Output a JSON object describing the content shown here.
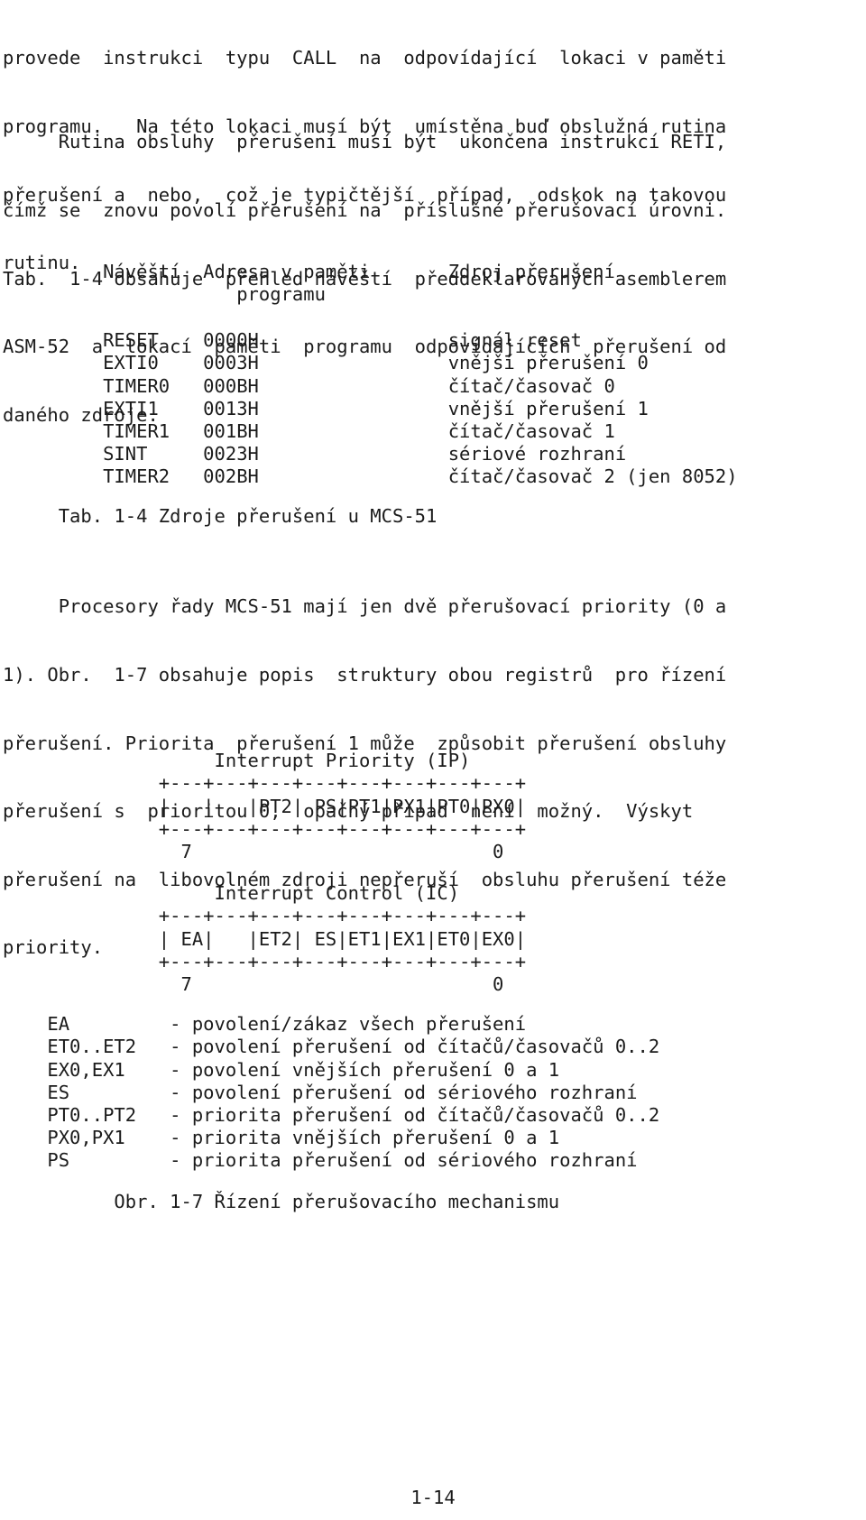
{
  "document": {
    "language": "cs",
    "page_number": "1-14"
  },
  "paragraphs": {
    "intro": [
      "provede  instrukci  typu  CALL  na  odpovídající  lokaci v paměti",
      "programu.   Na této lokaci musí být  umístěna buď obslužná rutina",
      "přerušení a  nebo,  což je typičtější  případ,  odskok na takovou",
      "rutinu."
    ],
    "rutina": [
      "     Rutina obsluhy  přerušení musí být  ukončena instrukcí RETI,",
      "čímž se  znovu povolí přerušení na  příslušné přerušovací úrovni.",
      "Tab.  1-4 obsahuje  přehled návěští  předdeklarovaných asemblerem",
      "ASM-52  a  lokací  paměti  programu  odpovídajících  přerušení od",
      "daného zdroje."
    ],
    "priority": [
      "     Procesory řady MCS-51 mají jen dvě přerušovací priority (0 a",
      "1). Obr.  1-7 obsahuje popis  struktury obou registrů  pro řízení",
      "přerušení. Priorita  přerušení 1 může  způsobit přerušení obsluhy",
      "přerušení s  prioritou 0,  opačný případ  není  možný.  Výskyt",
      "přerušení na  libovolném zdroji nepřeruší  obsluhu přerušení téže",
      "priority."
    ]
  },
  "table_1_4": {
    "headers": {
      "col1": "Návěští",
      "col2_line1": "Adresa v paměti",
      "col2_line2": "programu",
      "col3": "Zdroj přerušení"
    },
    "header_lines": [
      "     Návěští  Adresa v paměti       Zdroj přerušení",
      "                 programu"
    ],
    "rows": [
      {
        "label": "RESET",
        "address": "0000H",
        "source": "signál reset"
      },
      {
        "label": "EXTI0",
        "address": "0003H",
        "source": "vnější přerušení 0"
      },
      {
        "label": "TIMER0",
        "address": "000BH",
        "source": "čítač/časovač 0"
      },
      {
        "label": "EXTI1",
        "address": "0013H",
        "source": "vnější přerušení 1"
      },
      {
        "label": "TIMER1",
        "address": "001BH",
        "source": "čítač/časovač 1"
      },
      {
        "label": "SINT",
        "address": "0023H",
        "source": "sériové rozhraní"
      },
      {
        "label": "TIMER2",
        "address": "002BH",
        "source": "čítač/časovač 2 (jen 8052)"
      }
    ],
    "row_lines": [
      "     RESET    0000H                 signál reset",
      "     EXTI0    0003H                 vnější přerušení 0",
      "     TIMER0   000BH                 čítač/časovač 0",
      "     EXTI1    0013H                 vnější přerušení 1",
      "     TIMER1   001BH                 čítač/časovač 1",
      "     SINT     0023H                 sériové rozhraní",
      "     TIMER2   002BH                 čítač/časovač 2 (jen 8052)"
    ],
    "caption": "     Tab. 1-4 Zdroje přerušení u MCS-51"
  },
  "registers": {
    "ip": {
      "title": "Interrupt Priority (IP)",
      "title_line": "               Interrupt Priority (IP)",
      "bits": [
        "",
        "",
        "PT2",
        "PS",
        "PT1",
        "PX1",
        "PT0",
        "PX0"
      ],
      "msb_label": "7",
      "lsb_label": "0",
      "art": [
        "               Interrupt Priority (IP)",
        "          +---+---+---+---+---+---+---+---+",
        "          |   |   |PT2| PS|PT1|PX1|PT0|PX0|",
        "          +---+---+---+---+---+---+---+---+",
        "            7                           0"
      ]
    },
    "ic": {
      "title": "Interrupt Control (IC)",
      "title_line": "               Interrupt Control (IC)",
      "bits": [
        "EA",
        "",
        "ET2",
        "ES",
        "ET1",
        "EX1",
        "ET0",
        "EX0"
      ],
      "msb_label": "7",
      "lsb_label": "0",
      "art": [
        "               Interrupt Control (IC)",
        "          +---+---+---+---+---+---+---+---+",
        "          | EA|   |ET2| ES|ET1|EX1|ET0|EX0|",
        "          +---+---+---+---+---+---+---+---+",
        "            7                           0"
      ]
    }
  },
  "legend": {
    "entries": [
      {
        "symbol": "EA",
        "description": "povolení/zákaz všech přerušení"
      },
      {
        "symbol": "ET0..ET2",
        "description": "povolení přerušení od čítačů/časovačů 0..2"
      },
      {
        "symbol": "EX0,EX1",
        "description": "povolení vnějších přerušení 0 a 1"
      },
      {
        "symbol": "ES",
        "description": "povolení přerušení od sériového rozhraní"
      },
      {
        "symbol": "PT0..PT2",
        "description": "priorita přerušení od čítačů/časovačů 0..2"
      },
      {
        "symbol": "PX0,PX1",
        "description": "priorita vnějších přerušení 0 a 1"
      },
      {
        "symbol": "PS",
        "description": "priorita přerušení od sériového rozhraní"
      }
    ],
    "lines": [
      "EA         - povolení/zákaz všech přerušení",
      "ET0..ET2   - povolení přerušení od čítačů/časovačů 0..2",
      "EX0,EX1    - povolení vnějších přerušení 0 a 1",
      "ES         - povolení přerušení od sériového rozhraní",
      "PT0..PT2   - priorita přerušení od čítačů/časovačů 0..2",
      "PX0,PX1    - priorita vnějších přerušení 0 a 1",
      "PS         - priorita přerušení od sériového rozhraní"
    ]
  },
  "figure_caption": {
    "text": "          Obr. 1-7 Řízení přerušovacího mechanismu"
  },
  "footer": {
    "page_label": "1-14"
  }
}
